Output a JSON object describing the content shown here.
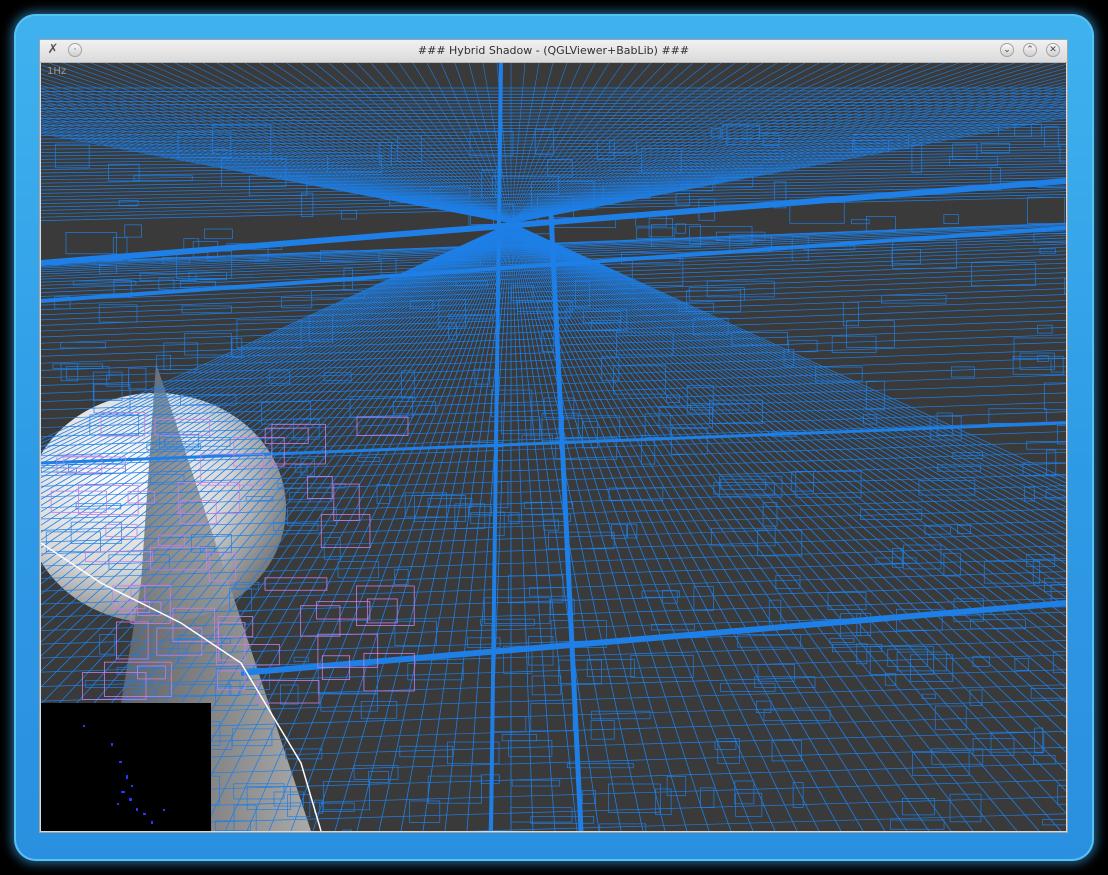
{
  "window": {
    "title": "### Hybrid Shadow - (QGLViewer+BabLib) ###",
    "icon": "app-icon",
    "buttons": {
      "menu": {
        "icon": "menu-icon",
        "glyph": "·"
      },
      "minimize": {
        "icon": "chevron-down-icon",
        "glyph": "⌄"
      },
      "maximize": {
        "icon": "chevron-up-icon",
        "glyph": "⌃"
      },
      "close": {
        "icon": "close-icon",
        "glyph": "✕"
      }
    }
  },
  "viewer": {
    "fps_text": "1Hz",
    "colors": {
      "background": "#3a3a3a",
      "wire": "#1e7fe6",
      "wire_secondary": "#c67ee6",
      "sphere": "#f2f2f2",
      "frame_glow": "#2e9ae6"
    }
  }
}
